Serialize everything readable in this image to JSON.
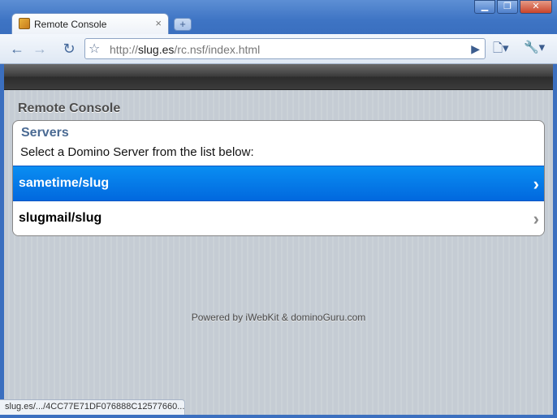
{
  "window": {
    "minimize_glyph": "▁",
    "restore_glyph": "❐",
    "close_glyph": "✕"
  },
  "tab": {
    "title": "Remote Console",
    "close_glyph": "×",
    "newtab_glyph": "+"
  },
  "toolbar": {
    "back_glyph": "←",
    "forward_glyph": "→",
    "reload_glyph": "↻",
    "star_glyph": "☆",
    "url_scheme": "http://",
    "url_host": "slug.es",
    "url_path": "/rc.nsf/index.html",
    "go_glyph": "▶",
    "page_menu_glyph": "🗋▾",
    "tools_menu_glyph": "🔧▾"
  },
  "page": {
    "title": "Remote Console",
    "panel": {
      "title": "Servers",
      "description": "Select a Domino Server from the list below:",
      "servers": [
        {
          "label": "sametime/slug",
          "chevron": "›",
          "selected": true
        },
        {
          "label": "slugmail/slug",
          "chevron": "›",
          "selected": false
        }
      ]
    },
    "footer": "Powered by iWebKit & dominoGuru.com"
  },
  "status": {
    "text": "slug.es/.../4CC77E71DF076888C12577660..."
  },
  "colors": {
    "selected_row": "#0168de",
    "panel_title": "#4a6a93",
    "background": "#c5ccd4"
  }
}
